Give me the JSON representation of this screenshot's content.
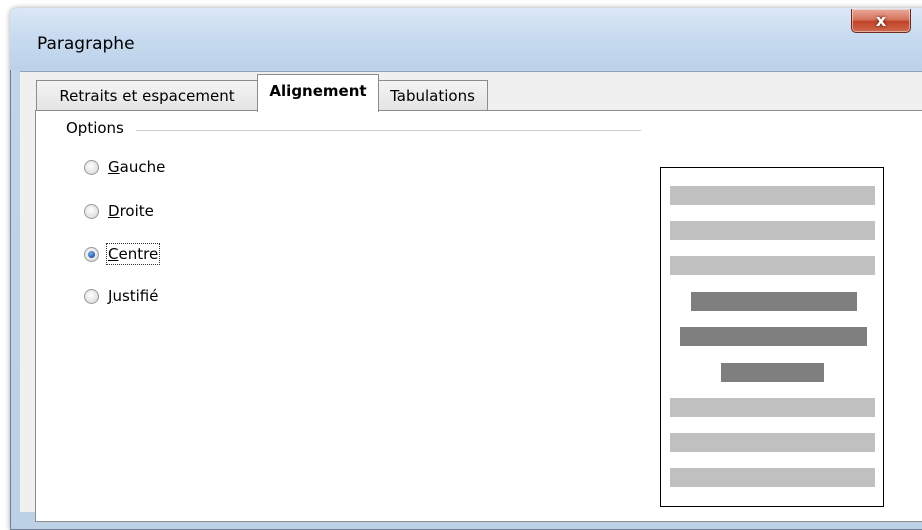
{
  "window": {
    "title": "Paragraphe",
    "close_glyph": "x"
  },
  "tabs": [
    {
      "label": "Retraits et espacement",
      "active": false
    },
    {
      "label": "Alignement",
      "active": true
    },
    {
      "label": "Tabulations",
      "active": false
    }
  ],
  "options": {
    "group_label": "Options",
    "radios": [
      {
        "pre": "",
        "mnemonic": "G",
        "post": "auche",
        "checked": false
      },
      {
        "pre": "",
        "mnemonic": "D",
        "post": "roite",
        "checked": false
      },
      {
        "pre": "",
        "mnemonic": "C",
        "post": "entre",
        "checked": true
      },
      {
        "pre": "",
        "mnemonic": "J",
        "post": "ustifié",
        "checked": false
      }
    ]
  },
  "preview": {
    "colors": {
      "context": "#c0c0c0",
      "current": "#7f7f7f",
      "border": "#000000"
    },
    "alignment": "center"
  }
}
